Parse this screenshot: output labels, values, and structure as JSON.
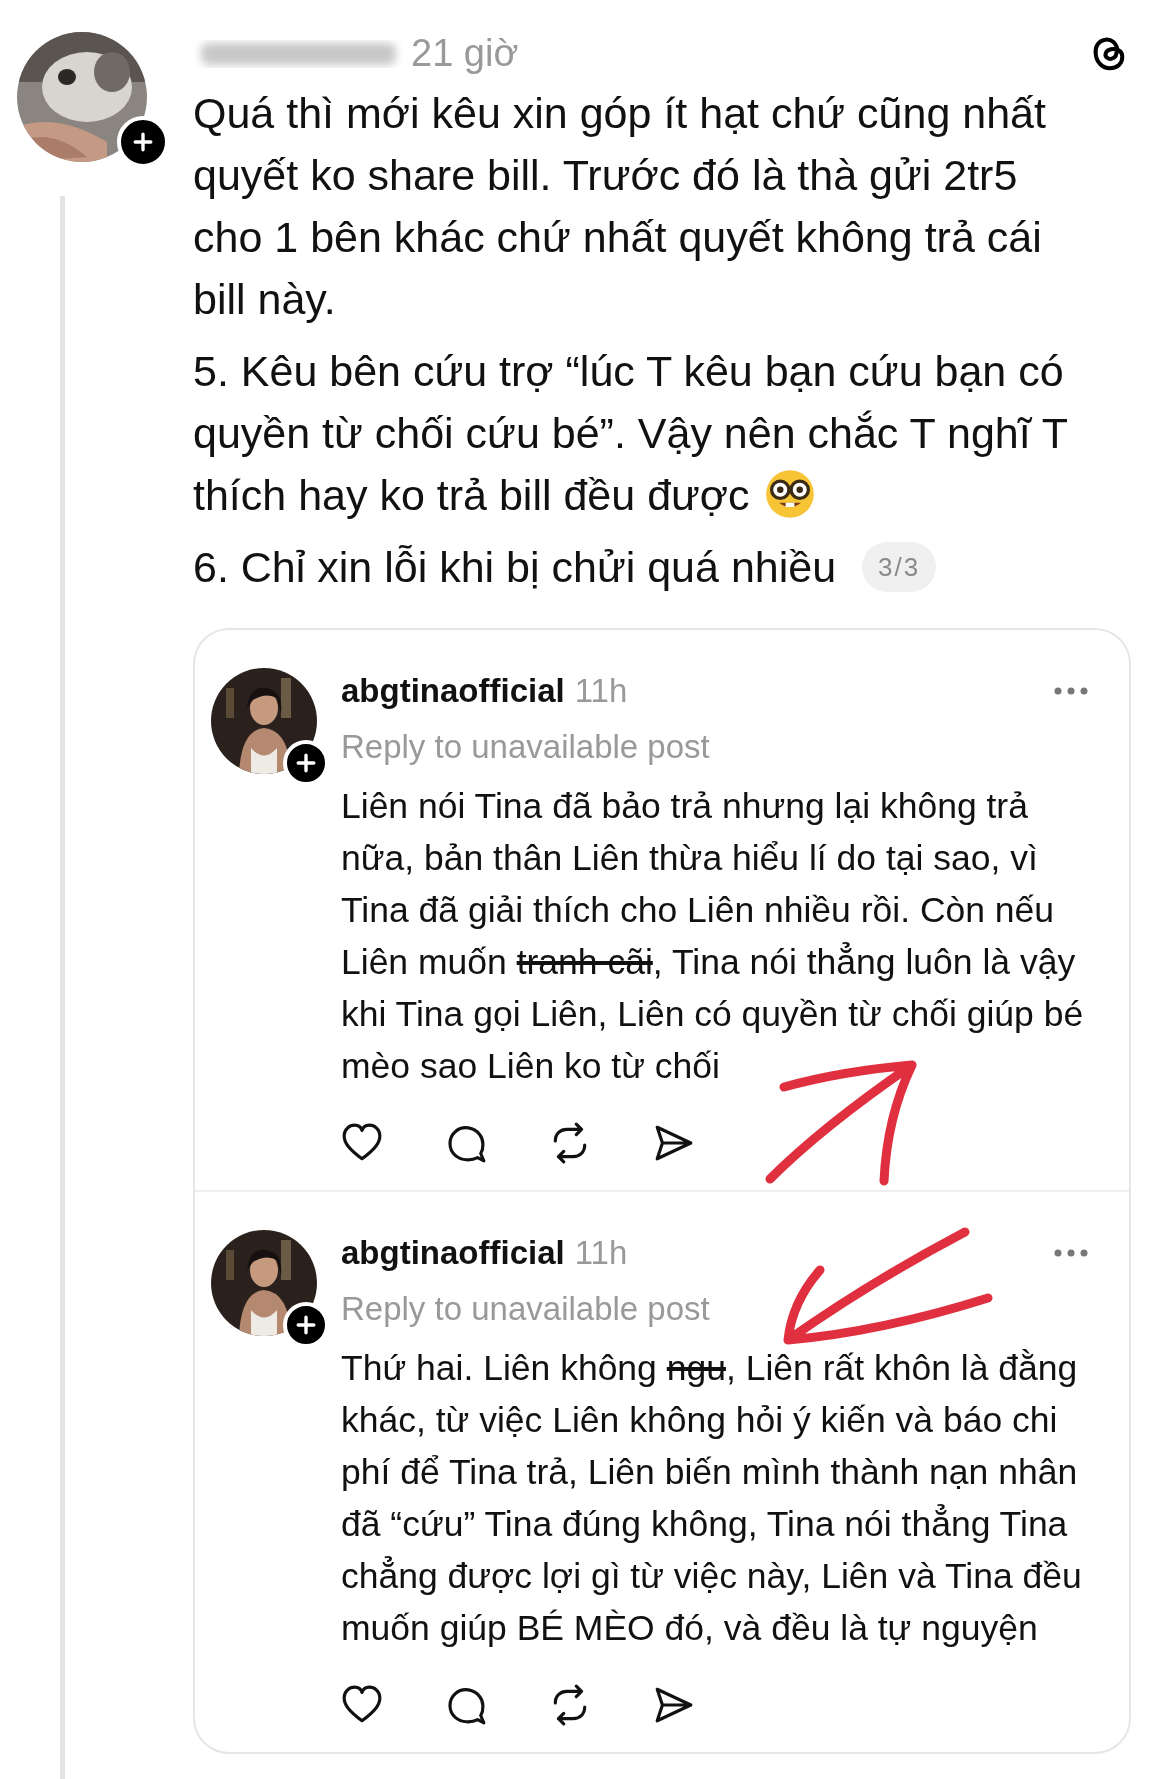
{
  "post": {
    "time": "21 giờ",
    "paragraphs": [
      {
        "text": "Quá thì mới kêu xin góp ít hạt chứ cũng nhất quyết ko share bill. Trước đó là thà gửi 2tr5 cho 1 bên khác chứ nhất quyết không trả cái bill này.",
        "kind": "plain"
      },
      {
        "text": "5. Kêu bên cứu trợ “lúc T kêu bạn cứu bạn có quyền từ chối cứu bé”. Vậy nên chắc T nghĩ T",
        "last_line": "thích hay ko trả bill đều được",
        "kind": "emoji"
      },
      {
        "text": "6. Chỉ xin lỗi khi bị chửi quá nhiều",
        "kind": "plain"
      }
    ],
    "counter": "3/3"
  },
  "quoted": [
    {
      "username": "abgtinaofficial",
      "time": "11h",
      "reply_note": "Reply to unavailable post",
      "body": [
        {
          "text": "Liên nói Tina đã bảo trả nhưng lại không trả nữa, bản thân Liên thừa hiểu lí do tại sao, vì Tina đã giải thích cho Liên nhiều rồi. Còn nếu Liên muốn ",
          "struck": false
        },
        {
          "text": "tranh cãi",
          "struck": true
        },
        {
          "text": ", Tina nói thẳng luôn là vậy khi Tina gọi Liên, Liên có quyền từ chối giúp bé mèo sao Liên ko từ chối",
          "struck": false
        }
      ]
    },
    {
      "username": "abgtinaofficial",
      "time": "11h",
      "reply_note": "Reply to unavailable post",
      "body": [
        {
          "text": "Thứ hai. Liên không ",
          "struck": false
        },
        {
          "text": "ngu",
          "struck": true
        },
        {
          "text": ", Liên rất khôn là đằng khác, từ việc Liên không hỏi ý kiến và báo chi phí để Tina trả, Liên biến mình thành nạn nhân đã “cứu” Tina đúng không, Tina nói thẳng Tina chẳng được lợi gì từ việc này, Liên và Tina đều muốn giúp BÉ MÈO đó, và đều là tự nguyện",
          "struck": false
        }
      ]
    }
  ]
}
